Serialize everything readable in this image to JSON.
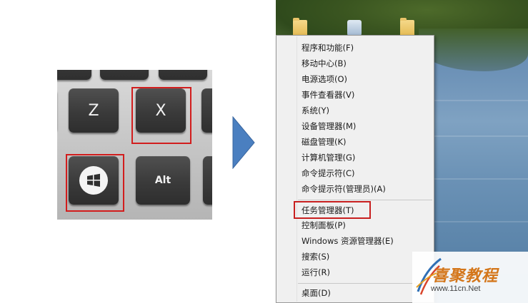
{
  "keyboard": {
    "keys": {
      "z": "Z",
      "x": "X",
      "alt": "Alt"
    }
  },
  "context_menu": {
    "items": [
      "程序和功能(F)",
      "移动中心(B)",
      "电源选项(O)",
      "事件查看器(V)",
      "系统(Y)",
      "设备管理器(M)",
      "磁盘管理(K)",
      "计算机管理(G)",
      "命令提示符(C)",
      "命令提示符(管理员)(A)",
      "任务管理器(T)",
      "控制面板(P)",
      "Windows 资源管理器(E)",
      "搜索(S)",
      "运行(R)",
      "桌面(D)"
    ]
  },
  "watermark": {
    "title": "喜聚教程",
    "url": "www.11cn.Net"
  },
  "colors": {
    "highlight": "#d21d1d",
    "arrow": "#4a7fc0"
  }
}
